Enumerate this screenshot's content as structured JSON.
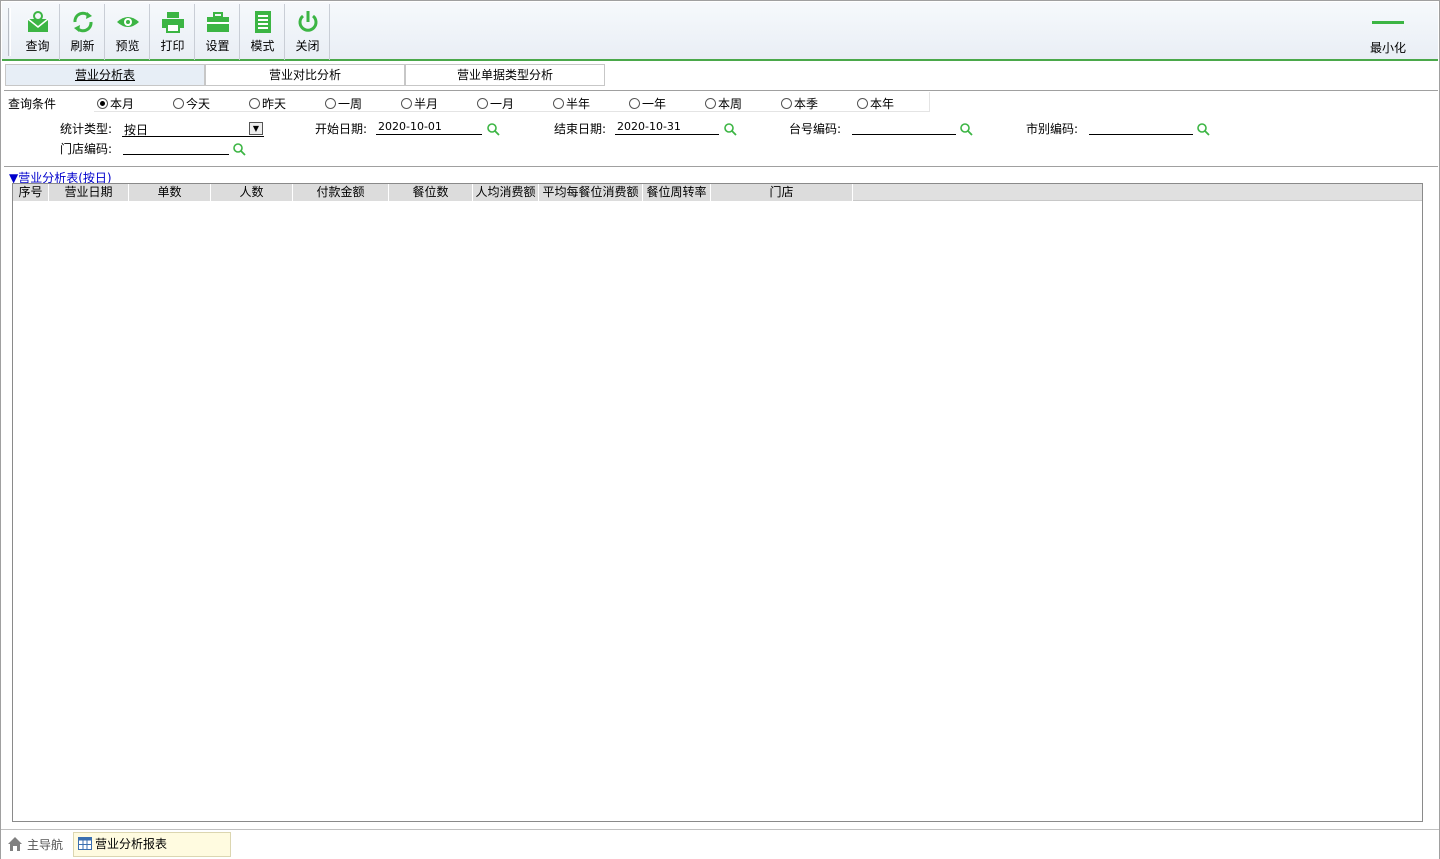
{
  "toolbar": {
    "buttons": [
      {
        "label": "查询",
        "icon": "query-icon"
      },
      {
        "label": "刷新",
        "icon": "refresh-icon"
      },
      {
        "label": "预览",
        "icon": "preview-icon"
      },
      {
        "label": "打印",
        "icon": "print-icon"
      },
      {
        "label": "设置",
        "icon": "settings-icon"
      },
      {
        "label": "模式",
        "icon": "mode-icon"
      },
      {
        "label": "关闭",
        "icon": "power-icon"
      }
    ],
    "minimize_label": "最小化"
  },
  "tabs": [
    {
      "label": "营业分析表",
      "active": true
    },
    {
      "label": "营业对比分析",
      "active": false
    },
    {
      "label": "营业单据类型分析",
      "active": false
    }
  ],
  "criteria": {
    "title": "查询条件",
    "periods": [
      "本月",
      "今天",
      "昨天",
      "一周",
      "半月",
      "一月",
      "半年",
      "一年",
      "本周",
      "本季",
      "本年"
    ],
    "selected_period": "本月",
    "stat_type_label": "统计类型:",
    "stat_type_value": "按日",
    "start_date_label": "开始日期:",
    "start_date_value": "2020-10-01",
    "end_date_label": "结束日期:",
    "end_date_value": "2020-10-31",
    "table_code_label": "台号编码:",
    "table_code_value": "",
    "market_code_label": "市别编码:",
    "market_code_value": "",
    "store_code_label": "门店编码:",
    "store_code_value": ""
  },
  "report": {
    "title": "▼营业分析表(按日)",
    "columns": [
      "序号",
      "营业日期",
      "单数",
      "人数",
      "付款金额",
      "餐位数",
      "人均消费额",
      "平均每餐位消费额",
      "餐位周转率",
      "门店"
    ]
  },
  "statusbar": {
    "home_label": "主导航",
    "active_doc_label": "营业分析报表"
  },
  "colors": {
    "accent": "#3cb544",
    "link": "#0000cc"
  }
}
